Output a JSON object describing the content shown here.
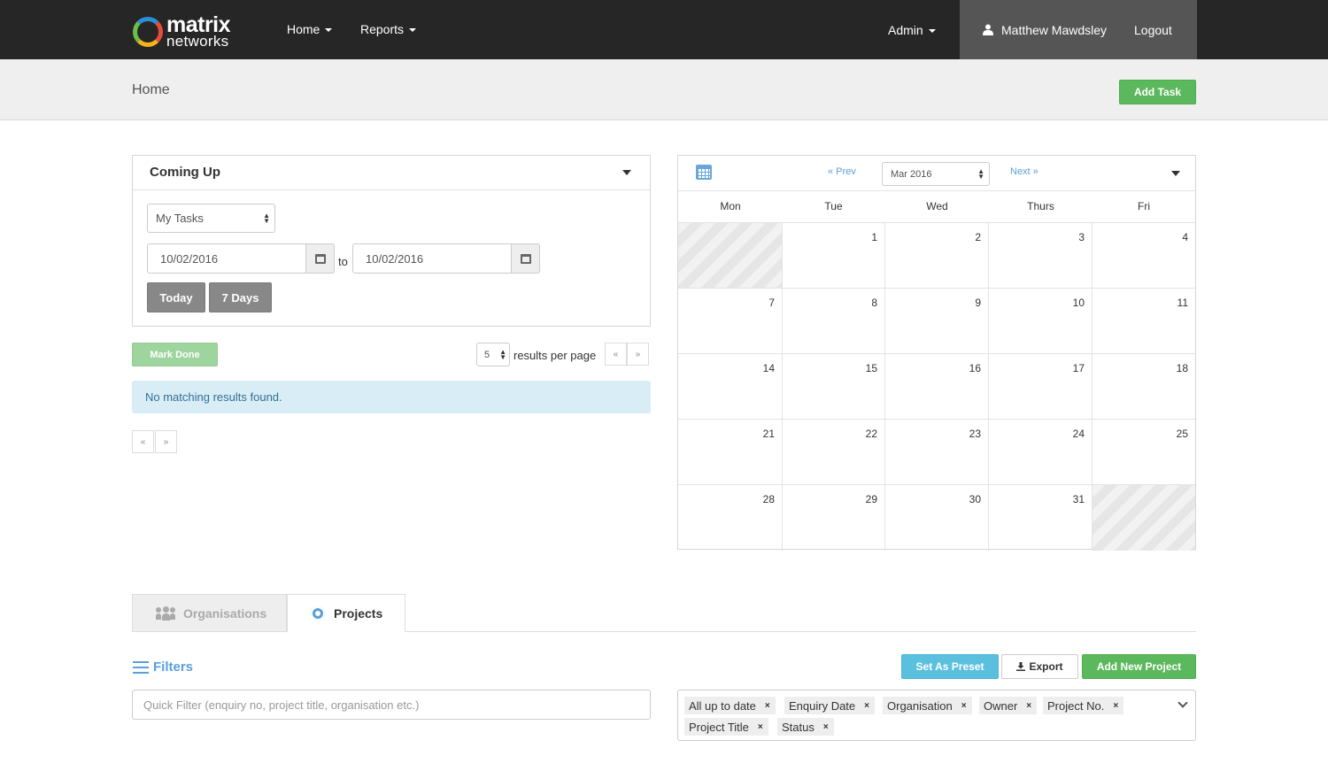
{
  "navbar": {
    "logo_line1": "matrix",
    "logo_line2": "networks",
    "home": "Home",
    "reports": "Reports",
    "admin": "Admin",
    "user_name": "Matthew Mawdsley",
    "logout": "Logout"
  },
  "subheader": {
    "title": "Home",
    "add_task": "Add Task"
  },
  "coming_up": {
    "title": "Coming Up",
    "task_filter": "My Tasks",
    "date_from": "10/02/2016",
    "date_to_label": "to",
    "date_to": "10/02/2016",
    "today_button": "Today",
    "seven_days_button": "7 Days",
    "mark_done": "Mark Done",
    "per_page_value": "5",
    "per_page_label": "results per page",
    "prev_symbol": "«",
    "next_symbol": "»",
    "no_results": "No matching results found."
  },
  "calendar": {
    "prev": "« Prev",
    "next": "Next »",
    "month_value": "Mar 2016",
    "days": [
      "Mon",
      "Tue",
      "Wed",
      "Thurs",
      "Fri"
    ],
    "weeks": [
      [
        "",
        "1",
        "2",
        "3",
        "4"
      ],
      [
        "7",
        "8",
        "9",
        "10",
        "11"
      ],
      [
        "14",
        "15",
        "16",
        "17",
        "18"
      ],
      [
        "21",
        "22",
        "23",
        "24",
        "25"
      ],
      [
        "28",
        "29",
        "30",
        "31",
        ""
      ]
    ]
  },
  "tabs": {
    "organisations": "Organisations",
    "projects": "Projects"
  },
  "filters": {
    "label": "Filters",
    "set_as_preset": "Set As Preset",
    "export": "Export",
    "add_new_project": "Add New Project",
    "quick_filter_placeholder": "Quick Filter (enquiry no, project title, organisation etc.)",
    "tags": [
      "All up to date",
      "Enquiry Date",
      "Organisation",
      "Owner",
      "Project No.",
      "Project Title",
      "Status"
    ],
    "remove_symbol": "×"
  },
  "colors": {
    "navbar": "#262626",
    "user_block": "#555555",
    "primary_green": "#5cb85c",
    "info_blue": "#5bc0de",
    "link_blue": "#5a9fd8",
    "alert_bg": "#d9edf7"
  }
}
